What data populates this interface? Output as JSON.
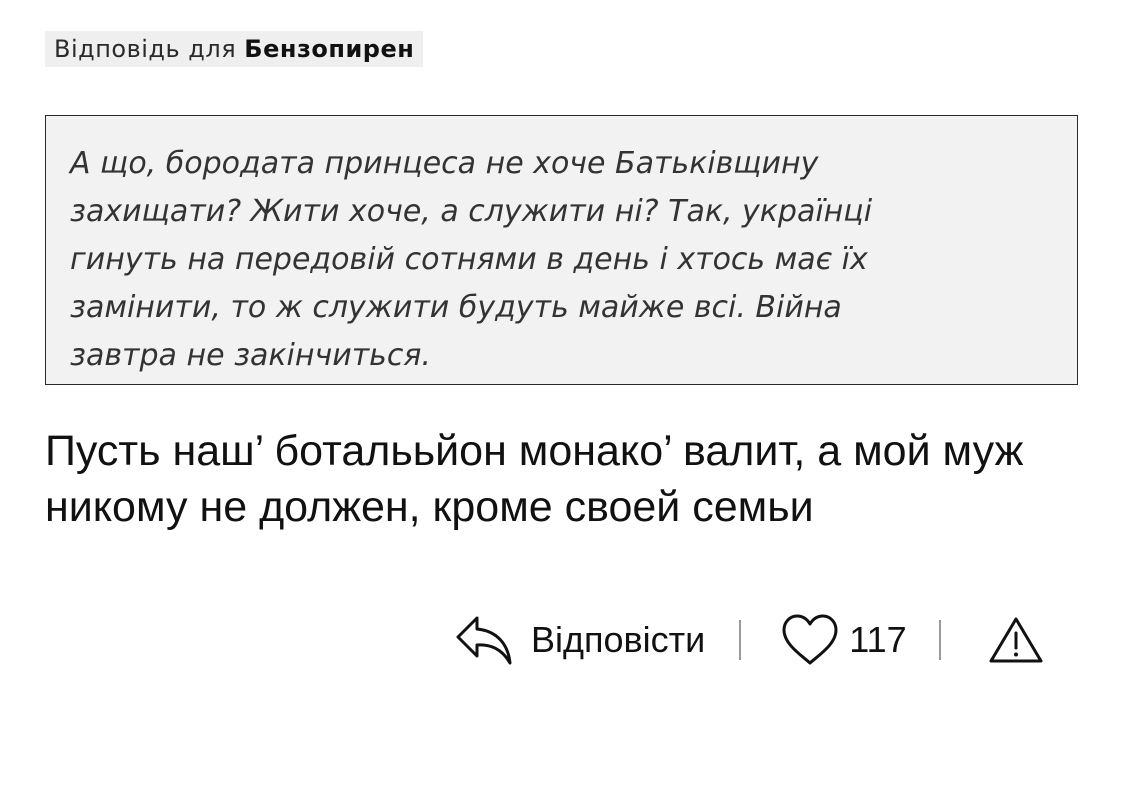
{
  "reply_to": {
    "prefix": "Відповідь для",
    "username": "Бензопирен"
  },
  "quote": {
    "text": "А що, бородата принцеса не хоче Батьківщину захищати? Жити хоче, а служити ні? Так, українці гинуть на передовій сотнями в день і хтось має їх замінити, то ж служити будуть майже всі. Війна завтра не закінчиться."
  },
  "comment": {
    "text": "Пусть наш’ боталььйон монако’ валит, а мой муж никому не должен, кроме своей семьи"
  },
  "actions": {
    "reply_label": "Відповісти",
    "reply_icon": "reply-arrow-icon",
    "like_icon": "heart-icon",
    "like_count": "117",
    "report_icon": "warning-triangle-icon"
  }
}
